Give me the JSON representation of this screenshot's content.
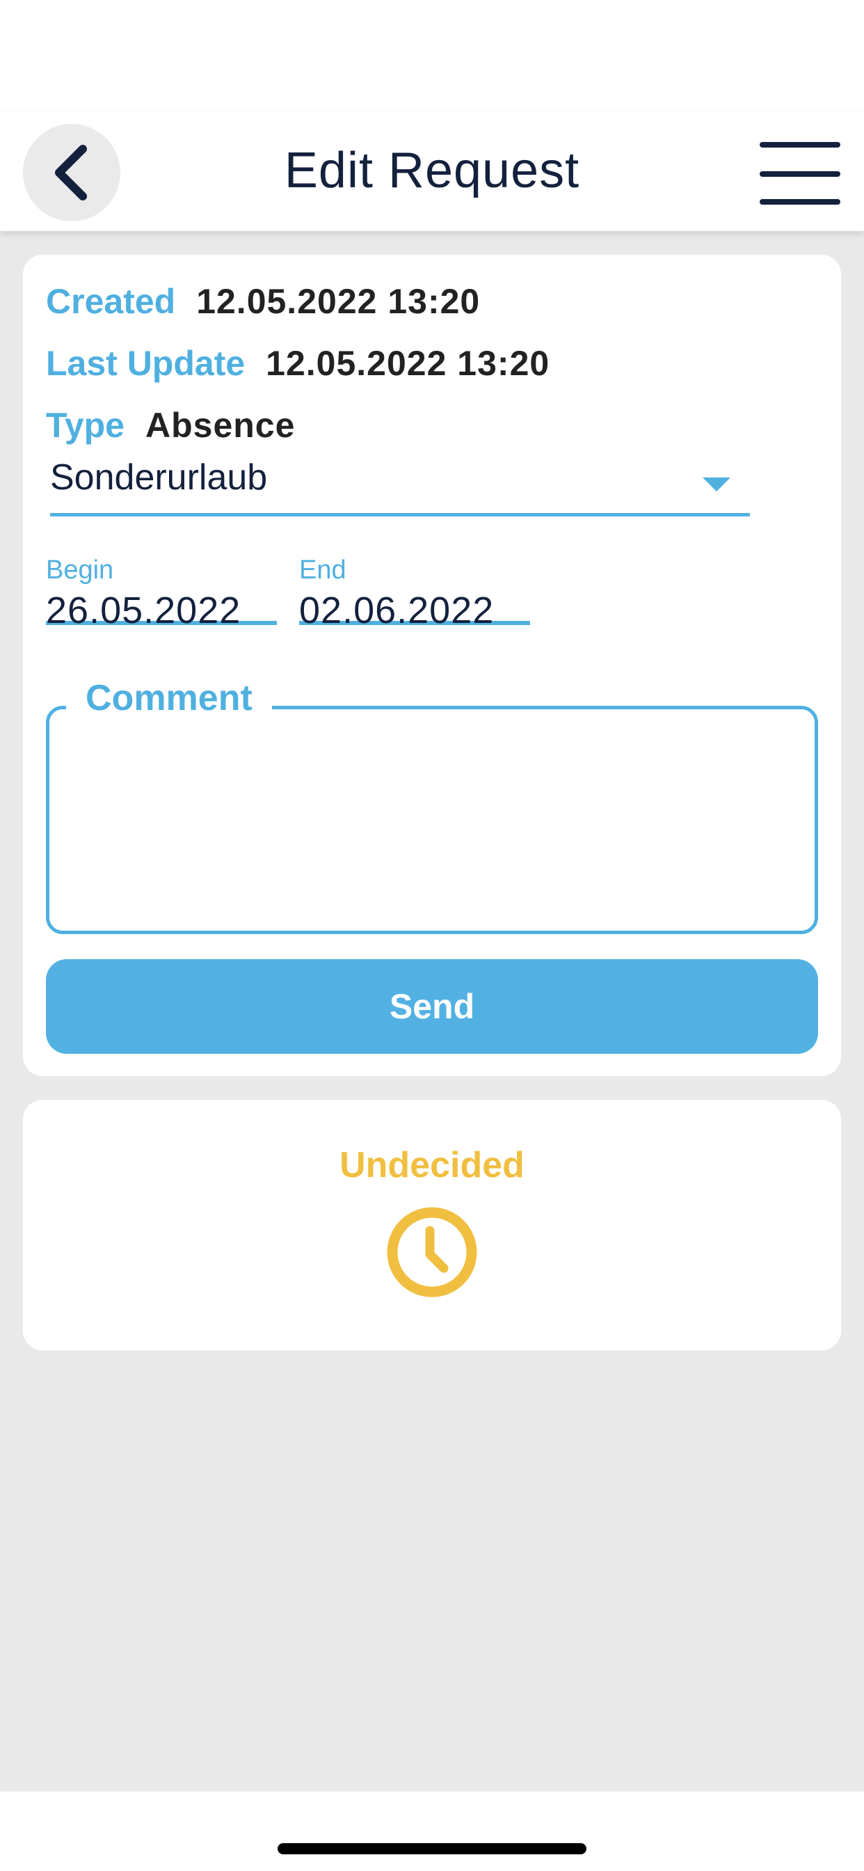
{
  "header": {
    "title": "Edit Request",
    "back_icon": "chevron-left-icon",
    "menu_icon": "hamburger-menu-icon"
  },
  "request": {
    "created_label": "Created",
    "created_value": "12.05.2022 13:20",
    "last_update_label": "Last Update",
    "last_update_value": "12.05.2022 13:20",
    "type_label": "Type",
    "type_value": "Absence",
    "subtype_selected": "Sonderurlaub",
    "begin_label": "Begin",
    "begin_value": "26.05.2022",
    "end_label": "End",
    "end_value": "02.06.2022",
    "comment_label": "Comment",
    "comment_value": "",
    "send_label": "Send"
  },
  "status": {
    "label": "Undecided",
    "icon": "clock-icon",
    "color": "#f0bf40"
  },
  "colors": {
    "accent": "#4fb0e0",
    "button": "#52b1e2",
    "text_dark": "#13213d",
    "background": "#e9e9e9"
  }
}
